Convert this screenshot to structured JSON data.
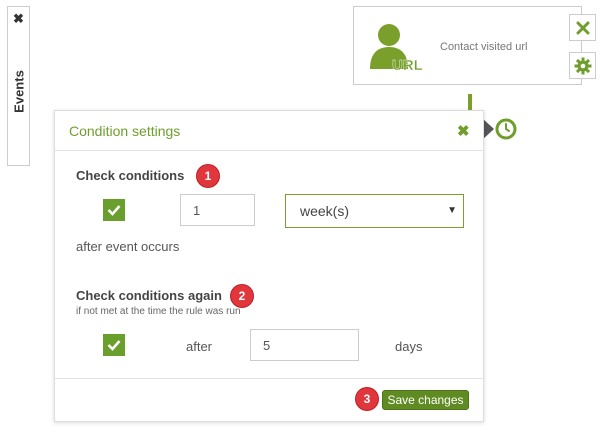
{
  "events_panel": {
    "close_glyph": "✖",
    "label": "Events"
  },
  "node": {
    "icon": "user-url-icon",
    "icon_text": "URL",
    "description": "Contact visited url",
    "close_icon": "close-icon",
    "settings_icon": "gear-icon"
  },
  "dialog": {
    "title": "Condition settings",
    "close_glyph": "✖",
    "check_conditions": {
      "title": "Check conditions",
      "badge": "1",
      "checked": true,
      "amount": "1",
      "unit_selected": "week(s)",
      "after_text": "after event occurs"
    },
    "check_again": {
      "title": "Check conditions again",
      "badge": "2",
      "subtitle": "if not met at the time the rule was run",
      "checked": true,
      "after_label": "after",
      "amount": "5",
      "unit": "days"
    },
    "footer": {
      "badge": "3",
      "save_label": "Save changes"
    }
  },
  "colors": {
    "accent": "#6f9e2d",
    "badge": "#e2363d",
    "button": "#5f8b22"
  }
}
